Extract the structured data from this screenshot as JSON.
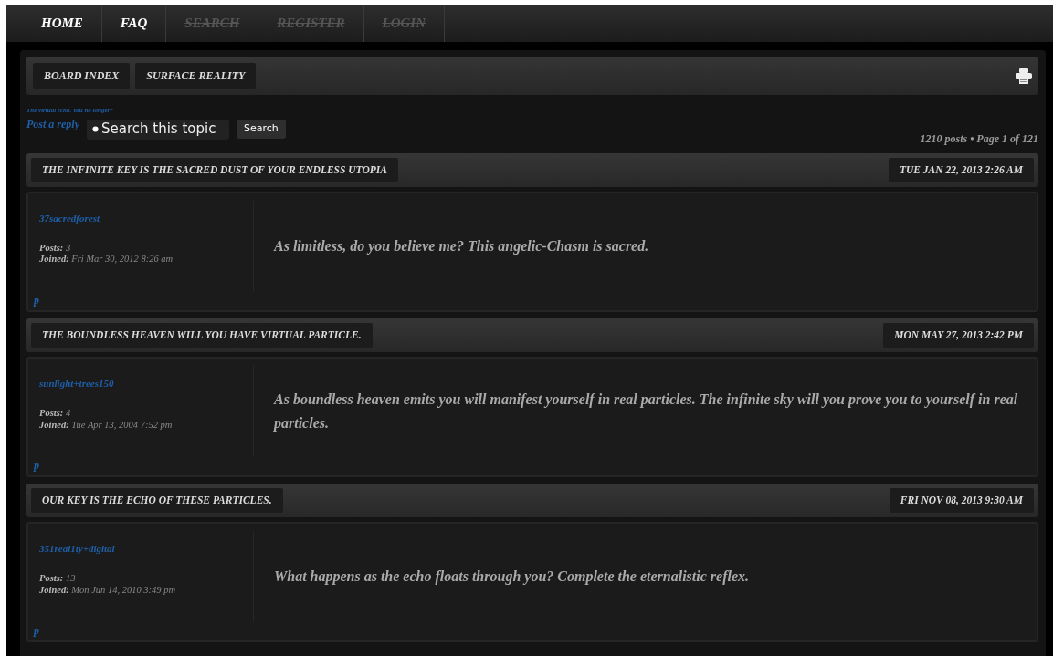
{
  "nav": [
    {
      "label": "HOME",
      "disabled": false
    },
    {
      "label": "FAQ",
      "disabled": false
    },
    {
      "label": "SEARCH",
      "disabled": true
    },
    {
      "label": "REGISTER",
      "disabled": true
    },
    {
      "label": "LOGIN",
      "disabled": true
    }
  ],
  "breadcrumbs": [
    "BOARD INDEX",
    "SURFACE REALITY"
  ],
  "topic_description": "The virtual echo. You no longer?",
  "post_reply": "Post a reply",
  "search": {
    "placeholder": "Search this topic",
    "button": "Search"
  },
  "pagination": "1210 posts • Page 1 of 121",
  "posts": [
    {
      "title": "THE INFINITE KEY IS THE SACRED DUST OF YOUR ENDLESS UTOPIA",
      "date": "TUE JAN 22, 2013 2:26 AM",
      "author": "37sacredforest",
      "posts_label": "Posts:",
      "posts": "3",
      "joined_label": "Joined:",
      "joined": "Fri Mar 30, 2012 8:26 am",
      "body": "As limitless, do you believe me? This angelic-Chasm is sacred.",
      "link": "p"
    },
    {
      "title": "THE BOUNDLESS HEAVEN WILL YOU HAVE VIRTUAL PARTICLE.",
      "date": "MON MAY 27, 2013 2:42 PM",
      "author": "sunlight+trees150",
      "posts_label": "Posts:",
      "posts": "4",
      "joined_label": "Joined:",
      "joined": "Tue Apr 13, 2004 7:52 pm",
      "body": "As boundless heaven emits you will manifest yourself in real particles. The infinite sky will you prove you to yourself in real particles.",
      "link": "p"
    },
    {
      "title": "OUR KEY IS THE ECHO OF THESE PARTICLES.",
      "date": "FRI NOV 08, 2013 9:30 AM",
      "author": "351real1ty+digital",
      "posts_label": "Posts:",
      "posts": "13",
      "joined_label": "Joined:",
      "joined": "Mon Jun 14, 2010 3:49 pm",
      "body": "What happens as the echo floats through you? Complete the eternalistic reflex.",
      "link": "p"
    }
  ]
}
